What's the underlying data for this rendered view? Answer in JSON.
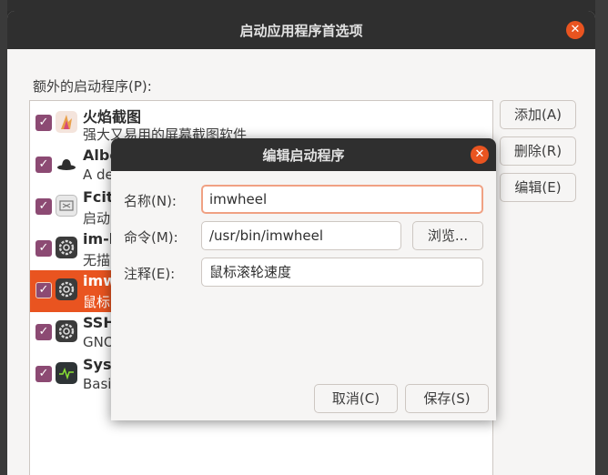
{
  "main_window": {
    "title": "启动应用程序首选项",
    "section_label": "额外的启动程序(P):",
    "buttons": {
      "add": "添加(A)",
      "delete": "删除(R)",
      "edit": "编辑(E)"
    },
    "close_glyph": "⊗",
    "programs": [
      {
        "name": "火焰截图",
        "description": "强大又易用的屏幕截图软件",
        "checked": true,
        "selected": false,
        "icon": "flameshot-icon"
      },
      {
        "name": "Albe",
        "description": "A de",
        "checked": true,
        "selected": false,
        "icon": "albert-hat-icon"
      },
      {
        "name": "Fcitx",
        "description": "启动",
        "checked": true,
        "selected": false,
        "icon": "fcitx-keyboard-icon"
      },
      {
        "name": "im-la",
        "description": "无描",
        "checked": true,
        "selected": false,
        "icon": "gear-icon"
      },
      {
        "name": "imw",
        "description": "鼠标",
        "checked": true,
        "selected": true,
        "icon": "gear-icon"
      },
      {
        "name": "SSH",
        "description": "GNO",
        "checked": true,
        "selected": false,
        "icon": "gear-icon"
      },
      {
        "name": "Syst",
        "description": "Basi",
        "checked": true,
        "selected": false,
        "icon": "system-monitor-icon"
      }
    ]
  },
  "dialog": {
    "title": "编辑启动程序",
    "name_label": "名称(N):",
    "name_value": "imwheel",
    "command_label": "命令(M):",
    "command_value": "/usr/bin/imwheel",
    "browse_label": "浏览...",
    "comment_label": "注释(E):",
    "comment_value": "鼠标滚轮速度",
    "cancel_label": "取消(C)",
    "save_label": "保存(S)",
    "close_glyph": "⊗"
  },
  "colors": {
    "accent": "#e95420",
    "checkbox": "#8c4a73",
    "titlebar": "#2f2f2f"
  }
}
